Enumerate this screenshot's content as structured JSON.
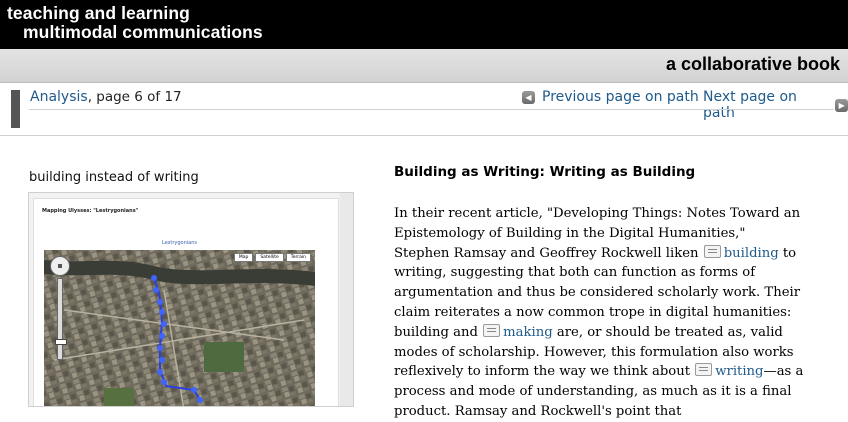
{
  "header": {
    "title_line1": "teaching and learning",
    "title_line2": "multimodal communications",
    "subtitle": "a collaborative book"
  },
  "path": {
    "link": "Analysis",
    "info": ", page 6 of 17",
    "prev_label": "Previous page on path",
    "next_label": "Next page on path"
  },
  "media": {
    "caption": "building instead of writing",
    "doc_title": "Mapping Ulysses: \"Lestrygonians\"",
    "map_label": "Lestrygonians",
    "map_buttons": [
      "Map",
      "Satellite",
      "Terrain"
    ],
    "map_show_labels": "Show labels"
  },
  "article": {
    "title": "Building as Writing: Writing as Building",
    "seg1": "In their recent article, \"Developing Things: Notes Toward an Epistemology of Building in the Digital Humanities,\" Stephen Ramsay and Geoffrey Rockwell liken ",
    "link1": "building",
    "seg2": " to writing, suggesting that both can function as forms of argumentation and thus be considered scholarly work. Their claim reiterates a now common trope in digital humanities: building and ",
    "link2": "making",
    "seg3": " are, or should be treated as, valid modes of scholarship. However, this formulation also works reflexively to inform the way we think about ",
    "link3": "writing",
    "seg4": "—as a process and mode of understanding, as much as it is a final product. Ramsay and Rockwell's point that"
  }
}
